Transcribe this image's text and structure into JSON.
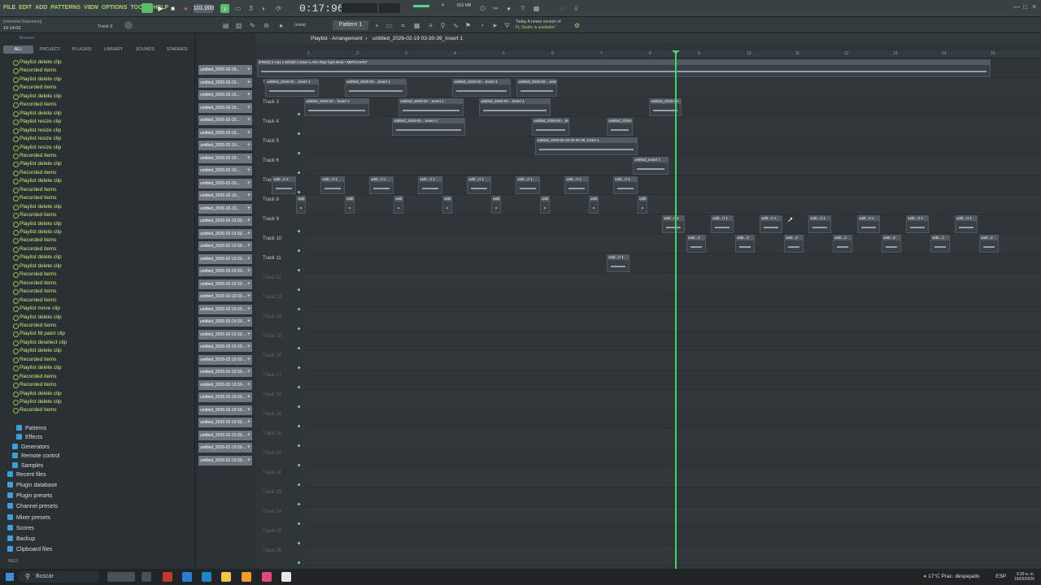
{
  "menu": [
    "FILE",
    "EDIT",
    "ADD",
    "PATTERNS",
    "VIEW",
    "OPTIONS",
    "TOOLS",
    "HELP"
  ],
  "tempo": "101.000",
  "time": "0:17:96",
  "memory": "653 MB",
  "cpu": "4",
  "hint_line1": "[metroRecStatement]",
  "hint_time": "10:14:00",
  "hint_track": "Track 9",
  "pattern": "Pattern 1",
  "snap": "(none)",
  "news_line1": "Today  A newer version of",
  "news_line2": "FL Studio is available!",
  "browser": {
    "title": "Browser",
    "tabs": [
      "ALL",
      "PROJECT",
      "PLUGINS",
      "LIBRARY",
      "SOUNDS",
      "STARRED"
    ],
    "history": [
      "Playlist delete clip",
      "Recorded items",
      "Playlist delete clip",
      "Recorded items",
      "Playlist delete clip",
      "Recorded items",
      "Playlist delete clip",
      "Playlist resize clip",
      "Playlist resize clip",
      "Playlist resize clip",
      "Playlist resize clip",
      "Recorded items",
      "Playlist delete clip",
      "Recorded items",
      "Playlist delete clip",
      "Recorded items",
      "Recorded items",
      "Playlist delete clip",
      "Recorded items",
      "Playlist delete clip",
      "Playlist delete clip",
      "Recorded items",
      "Recorded items",
      "Playlist delete clip",
      "Playlist delete clip",
      "Recorded items",
      "Recorded items",
      "Recorded items",
      "Recorded items",
      "Playlist move clip",
      "Playlist delete clip",
      "Recorded items",
      "Playlist fill paint clip",
      "Playlist deselect clip",
      "Playlist delete clip",
      "Recorded items",
      "Playlist delete clip",
      "Recorded items",
      "Recorded items",
      "Playlist delete clip",
      "Playlist delete clip",
      "Recorded items"
    ],
    "folders": [
      "Patterns",
      "Effects",
      "Generators",
      "Remote control",
      "Samples",
      "Recent files",
      "Plugin database",
      "Plugin presets",
      "Channel presets",
      "Mixer presets",
      "Scores",
      "Backup",
      "Clipboard files"
    ],
    "tags": "TAGS"
  },
  "picker_items": [
    "untitled_2026-02-19...",
    "untitled_2026-02-19...",
    "untitled_2026-02-19...",
    "untitled_2026-02-19...",
    "untitled_2026-02-19...",
    "untitled_2026-02-19...",
    "untitled_2026-02-19...",
    "untitled_2026-02-19...",
    "untitled_2026-02-19...",
    "untitled_2026-02-19...",
    "untitled_2026-02-19...",
    "untitled_2026-02-19...",
    "untitled_2026-02-19 03-...",
    "untitled_2026-02-19 03-...",
    "untitled_2026-02-19 03-...",
    "untitled_2026-02-19 03-...",
    "untitled_2026-02-19 03-...",
    "untitled_2026-02-19 03-...",
    "untitled_2026-02-19 03-...",
    "untitled_2026-02-19 03-...",
    "untitled_2026-02-19 03-...",
    "untitled_2026-02-19 03-...",
    "untitled_2026-02-19 03-...",
    "untitled_2026-02-19 03-...",
    "untitled_2026-02-19 03-...",
    "untitled_2026-02-19 03-...",
    "untitled_2026-02-19 03-...",
    "untitled_2026-02-19 03-...",
    "untitled_2026-02-19 03-...",
    "untitled_2026-02-19 03-...",
    "untitled_2026-02-19 03-...",
    "untitled_2026-02-19 03-..."
  ],
  "playlist": {
    "title": "Playlist - Arrangement",
    "file": "untitled_2026-02-19 03-30-39_Insert 1",
    "ruler": [
      "1",
      "2",
      "3",
      "4",
      "5",
      "6",
      "7",
      "8",
      "9",
      "10",
      "11",
      "12",
      "13",
      "14",
      "15"
    ],
    "tracks": [
      "Track 1",
      "Track 2",
      "Track 3",
      "Track 4",
      "Track 5",
      "Track 6",
      "Track 7",
      "Track 8",
      "Track 9",
      "Track 10",
      "Track 11",
      "Track 12",
      "Track 13",
      "Track 14",
      "Track 15",
      "Track 16",
      "Track 17",
      "Track 18",
      "Track 19",
      "Track 20",
      "Track 21",
      "Track 22",
      "Track 23",
      "Track 24",
      "Track 25",
      "Track 26"
    ],
    "beat_clip": "[FREE] 3 Hus x Wizkid x Dave x Afro Rap Type Beat • MERCHANT",
    "clip_label_long": "untitled_2026-02-19 03-30-39_Insert 1",
    "clip_label_mid": "untitled_2026-02-...Insert 1",
    "clip_label_short": "untit...rt 1",
    "clip_label_track6": "untitled_Insert 1",
    "clip_label_track10": "untit...2"
  },
  "taskbar": {
    "search": "Buscar",
    "weather": "17°C  Prac. despejado",
    "lang": "ESP",
    "clock_time": "3:39 a. m.",
    "clock_date": "19/02/2026"
  }
}
